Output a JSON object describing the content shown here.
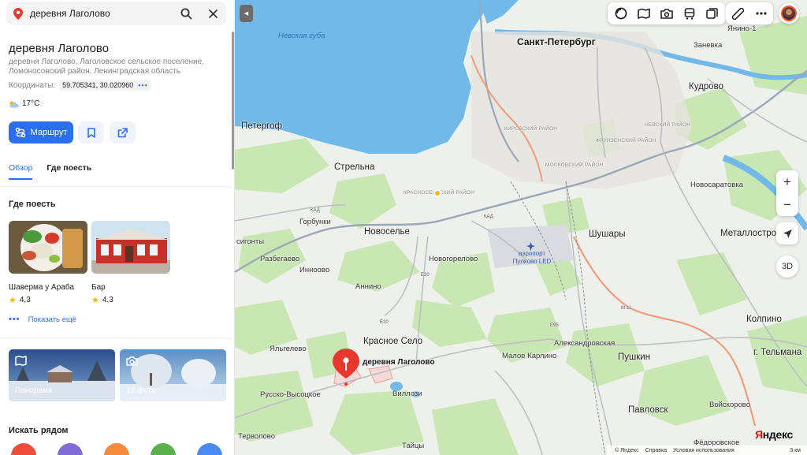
{
  "search": {
    "query": "деревня Лаголово"
  },
  "place": {
    "title": "деревня Лаголово",
    "address": "деревня Лаголово, Лаголовское сельское поселение, Ломоносовский район, Ленинградская область",
    "coords_label": "Координаты:",
    "coords_value": "59.705341, 30.020960",
    "weather": "17°C"
  },
  "actions": {
    "route_label": "Маршрут"
  },
  "tabs": [
    {
      "label": "Обзор",
      "active": true
    },
    {
      "label": "Где поесть",
      "active": false
    }
  ],
  "where_to_eat": {
    "title": "Где поесть",
    "places": [
      {
        "name": "Шаверма у Араба",
        "rating": "4,3"
      },
      {
        "name": "Бар",
        "rating": "4,3"
      }
    ],
    "show_more": "Показать ещё"
  },
  "media": {
    "panorama_label": "Панорама",
    "photos_label": "13 фото"
  },
  "nearby": {
    "title": "Искать рядом"
  },
  "map": {
    "marker_label": "деревня Лаголово",
    "labels": {
      "spb": "Санкт-Петербург",
      "neva_bay": "Невская губа",
      "peterhof": "Петергоф",
      "strelna": "Стрельна",
      "novoselye": "Новоселье",
      "gorbunki": "Горбунки",
      "razbegaevo": "Разбегаево",
      "innolovo": "Инноово",
      "annino": "Аннино",
      "novogorelovo": "Новогорелово",
      "shushary": "Шушары",
      "kudrovo": "Кудрово",
      "yanino": "Янино-1",
      "zanevka": "Заневка",
      "novosaratovka": "Новосаратовка",
      "metallostroy": "Металлострой",
      "kolpino": "Колпино",
      "pushkin": "Пушкин",
      "pavlovsk": "Павловск",
      "krasnoe_selo": "Красное Село",
      "yalgelevo": "Яльгелево",
      "russko_vysotskoe": "Русско-Высоцкое",
      "villozi": "Виллози",
      "tervolovo": "Терволово",
      "taitsy": "Тайцы",
      "maloe_karlino": "Малое Карлино",
      "aleksandrovskaya": "Александровская",
      "telmana": "г. Тельмана",
      "voyskorovo": "Войскорово",
      "fedorovskoe": "Фёдоровское",
      "sigonty": "сигонты",
      "airport": "аэропорт Пулково LED",
      "krasnoselsky": "КРАСНОСЕЛЬСКИЙ РАЙОН",
      "kirovsky": "КИРОВСКИЙ РАЙОН",
      "moskovsky": "МОСКОВСКИЙ РАЙОН",
      "frunzensky": "ФРУНЗЕНСКИЙ РАЙОН",
      "nevsky": "НЕВСКИЙ РАЙОН",
      "road_kad": "КАД",
      "road_e20": "E20",
      "road_e95": "E95",
      "road_m11": "M-11"
    },
    "brand": "Яндекс",
    "footer_links": [
      "© Яндекс",
      "Справка",
      "Условия использования"
    ],
    "scale": "3 км",
    "btn_3d": "3D"
  },
  "colors": {
    "accent": "#2b6ef0",
    "marker": "#e8372d",
    "water": "#70b9e8",
    "park": "#c9e7b3"
  }
}
